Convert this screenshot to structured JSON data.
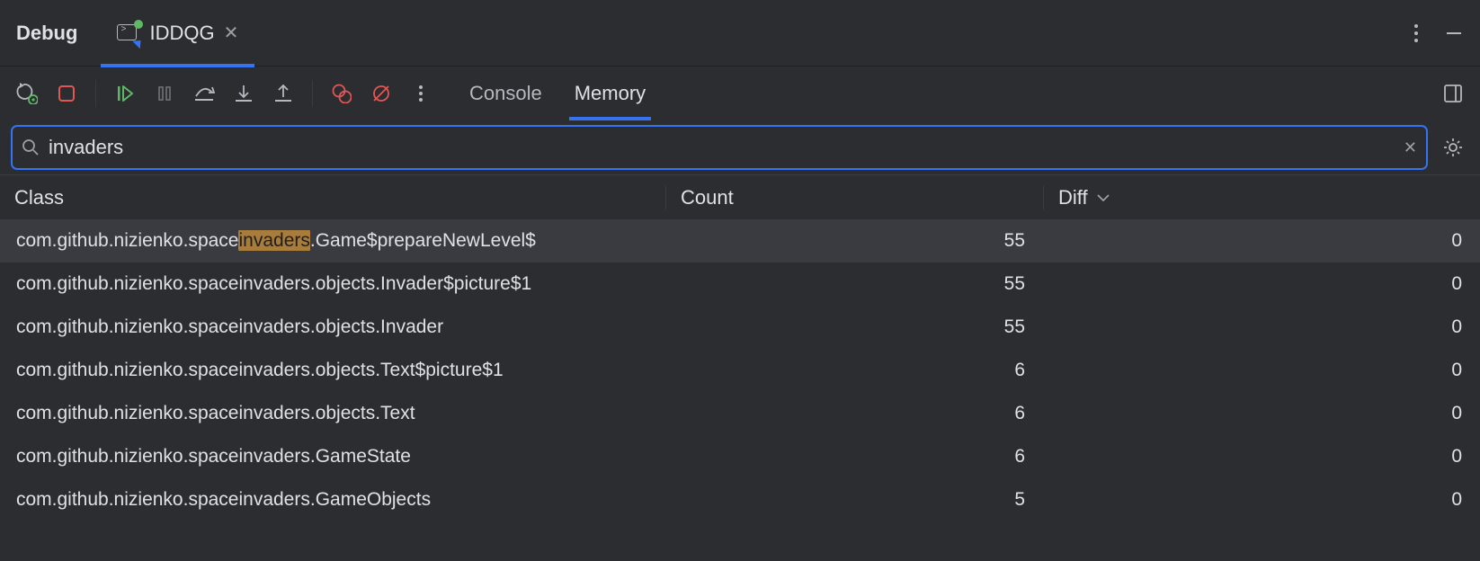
{
  "panel": {
    "title": "Debug",
    "runConfig": "IDDQG"
  },
  "toolbar": {
    "tabs": {
      "console": "Console",
      "memory": "Memory",
      "active": "memory"
    }
  },
  "search": {
    "value": "invaders"
  },
  "table": {
    "columns": {
      "class": "Class",
      "count": "Count",
      "diff": "Diff"
    },
    "sort": {
      "column": "diff",
      "dir": "desc"
    },
    "rows": [
      {
        "class_pre": "com.github.nizienko.space",
        "class_hl": "invaders",
        "class_post": ".Game$prepareNewLevel$",
        "count": 55,
        "diff": 0,
        "selected": true
      },
      {
        "class_pre": "com.github.nizienko.spaceinvaders.objects.Invader$picture$1",
        "class_hl": "",
        "class_post": "",
        "count": 55,
        "diff": 0
      },
      {
        "class_pre": "com.github.nizienko.spaceinvaders.objects.Invader",
        "class_hl": "",
        "class_post": "",
        "count": 55,
        "diff": 0
      },
      {
        "class_pre": "com.github.nizienko.spaceinvaders.objects.Text$picture$1",
        "class_hl": "",
        "class_post": "",
        "count": 6,
        "diff": 0
      },
      {
        "class_pre": "com.github.nizienko.spaceinvaders.objects.Text",
        "class_hl": "",
        "class_post": "",
        "count": 6,
        "diff": 0
      },
      {
        "class_pre": "com.github.nizienko.spaceinvaders.GameState",
        "class_hl": "",
        "class_post": "",
        "count": 6,
        "diff": 0
      },
      {
        "class_pre": "com.github.nizienko.spaceinvaders.GameObjects",
        "class_hl": "",
        "class_post": "",
        "count": 5,
        "diff": 0
      }
    ]
  }
}
